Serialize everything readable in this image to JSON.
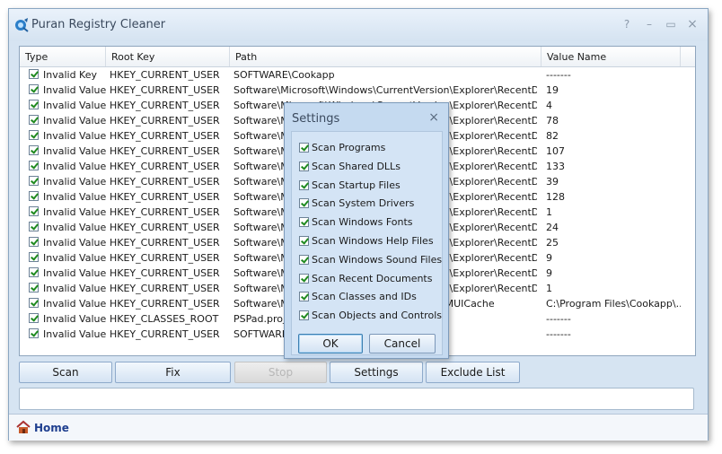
{
  "window": {
    "title": "Puran Registry Cleaner"
  },
  "titlebar_buttons": {
    "help": "?",
    "minimize": "–",
    "maximize": "▭",
    "close": "×"
  },
  "columns": {
    "type": "Type",
    "root_key": "Root Key",
    "path": "Path",
    "value_name": "Value Name"
  },
  "rows": [
    {
      "type": "Invalid Key",
      "root": "HKEY_CURRENT_USER",
      "path": "SOFTWARE\\Cookapp",
      "value": "-------"
    },
    {
      "type": "Invalid Value",
      "root": "HKEY_CURRENT_USER",
      "path": "Software\\Microsoft\\Windows\\CurrentVersion\\Explorer\\RecentDocs\\",
      "value": "19"
    },
    {
      "type": "Invalid Value",
      "root": "HKEY_CURRENT_USER",
      "path": "Software\\Microsoft\\Windows\\CurrentVersion\\Explorer\\RecentDocs\\",
      "value": "4"
    },
    {
      "type": "Invalid Value",
      "root": "HKEY_CURRENT_USER",
      "path": "Software\\Microsoft\\Windows\\CurrentVersion\\Explorer\\RecentDocs\\",
      "value": "78"
    },
    {
      "type": "Invalid Value",
      "root": "HKEY_CURRENT_USER",
      "path": "Software\\Microsoft\\Windows\\CurrentVersion\\Explorer\\RecentDocs\\",
      "value": "82"
    },
    {
      "type": "Invalid Value",
      "root": "HKEY_CURRENT_USER",
      "path": "Software\\Microsoft\\Windows\\CurrentVersion\\Explorer\\RecentDocs\\",
      "value": "107"
    },
    {
      "type": "Invalid Value",
      "root": "HKEY_CURRENT_USER",
      "path": "Software\\Microsoft\\Windows\\CurrentVersion\\Explorer\\RecentDocs\\",
      "value": "133"
    },
    {
      "type": "Invalid Value",
      "root": "HKEY_CURRENT_USER",
      "path": "Software\\Microsoft\\Windows\\CurrentVersion\\Explorer\\RecentDocs\\",
      "value": "39"
    },
    {
      "type": "Invalid Value",
      "root": "HKEY_CURRENT_USER",
      "path": "Software\\Microsoft\\Windows\\CurrentVersion\\Explorer\\RecentDocs\\",
      "value": "128"
    },
    {
      "type": "Invalid Value",
      "root": "HKEY_CURRENT_USER",
      "path": "Software\\Microsoft\\Windows\\CurrentVersion\\Explorer\\RecentDocs\\",
      "value": "1"
    },
    {
      "type": "Invalid Value",
      "root": "HKEY_CURRENT_USER",
      "path": "Software\\Microsoft\\Windows\\CurrentVersion\\Explorer\\RecentDocs\\",
      "value": "24"
    },
    {
      "type": "Invalid Value",
      "root": "HKEY_CURRENT_USER",
      "path": "Software\\Microsoft\\Windows\\CurrentVersion\\Explorer\\RecentDocs\\",
      "value": "25"
    },
    {
      "type": "Invalid Value",
      "root": "HKEY_CURRENT_USER",
      "path": "Software\\Microsoft\\Windows\\CurrentVersion\\Explorer\\RecentDocs...",
      "value": "9"
    },
    {
      "type": "Invalid Value",
      "root": "HKEY_CURRENT_USER",
      "path": "Software\\Microsoft\\Windows\\CurrentVersion\\Explorer\\RecentDocs...",
      "value": "9"
    },
    {
      "type": "Invalid Value",
      "root": "HKEY_CURRENT_USER",
      "path": "Software\\Microsoft\\Windows\\CurrentVersion\\Explorer\\RecentDocs...",
      "value": "1"
    },
    {
      "type": "Invalid Value",
      "root": "HKEY_CURRENT_USER",
      "path": "Software\\Microsoft\\Windows\\ShellNoRoam\\MUICache",
      "value": "C:\\Program Files\\Cookapp\\..."
    },
    {
      "type": "Invalid Value",
      "root": "HKEY_CLASSES_ROOT",
      "path": "PSPad.project",
      "value": "-------"
    },
    {
      "type": "Invalid Value",
      "root": "HKEY_CURRENT_USER",
      "path": "SOFTWARE\\Cookapp",
      "value": "-------"
    }
  ],
  "buttons": {
    "scan": "Scan",
    "fix": "Fix",
    "stop": "Stop",
    "settings": "Settings",
    "exclude": "Exclude List"
  },
  "nav": {
    "home": "Home"
  },
  "dialog": {
    "title": "Settings",
    "close": "×",
    "options": [
      "Scan Programs",
      "Scan Shared DLLs",
      "Scan Startup Files",
      "Scan System Drivers",
      "Scan Windows Fonts",
      "Scan Windows Help Files",
      "Scan Windows Sound Files",
      "Scan Recent Documents",
      "Scan Classes and IDs",
      "Scan Objects and Controls"
    ],
    "ok": "OK",
    "cancel": "Cancel"
  },
  "colors": {
    "window_bg": "#d6e4f2",
    "dialog_bg": "#c5daf0",
    "check": "#1f8a1f"
  }
}
